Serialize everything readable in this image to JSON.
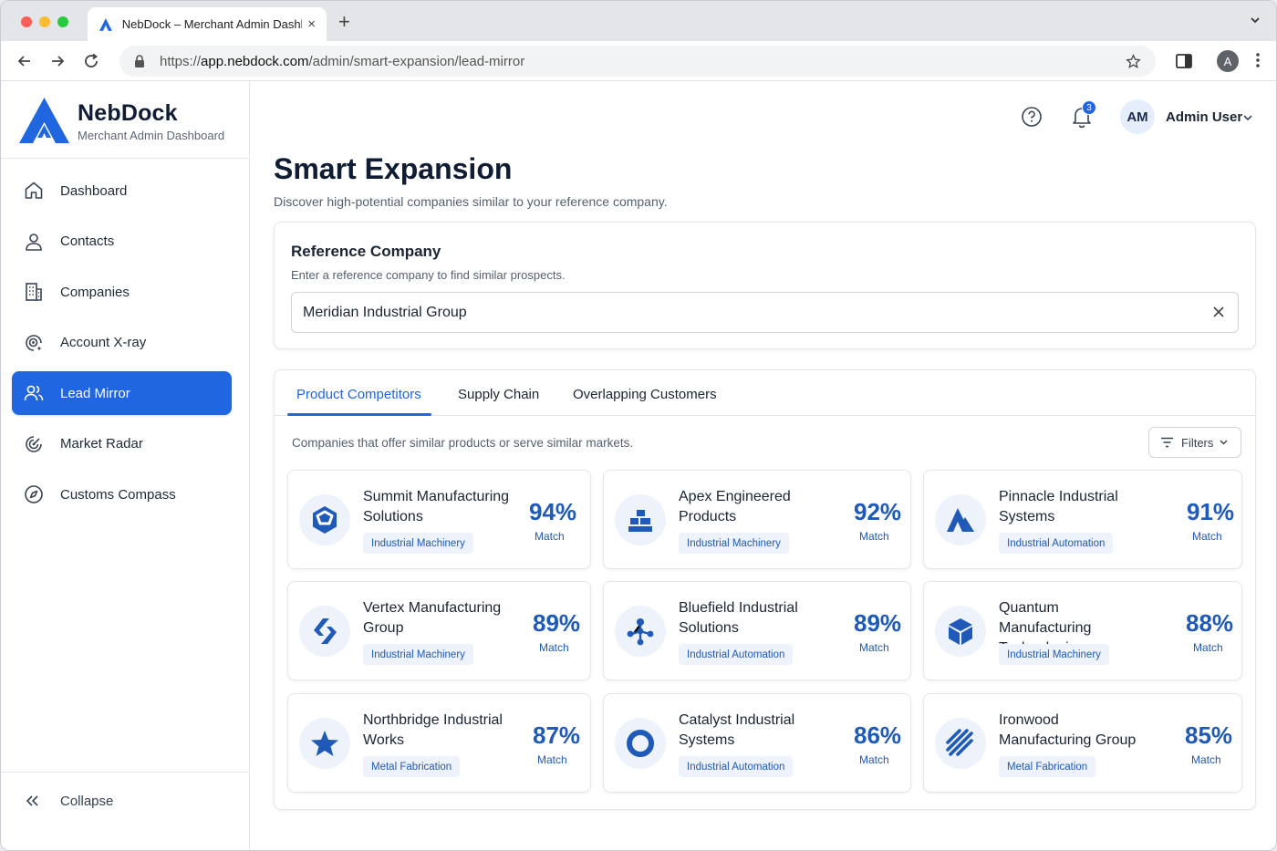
{
  "browser": {
    "tab_title": "NebDock – Merchant Admin Dashboard",
    "new_tab_label": "+",
    "url_scheme": "https://",
    "url_host": "app.nebdock.com",
    "url_path": "/admin/smart-expansion/lead-mirror",
    "profile_initial": "A",
    "close_label": "×"
  },
  "sidebar": {
    "brand_name": "NebDock",
    "brand_sub": "Merchant Admin Dashboard",
    "items": [
      {
        "label": "Dashboard",
        "icon": "home-icon",
        "active": false
      },
      {
        "label": "Contacts",
        "icon": "user-icon",
        "active": false
      },
      {
        "label": "Companies",
        "icon": "building-icon",
        "active": false
      },
      {
        "label": "Account X-ray",
        "icon": "xray-icon",
        "active": false
      },
      {
        "label": "Lead Mirror",
        "icon": "users-icon",
        "active": true
      },
      {
        "label": "Market Radar",
        "icon": "radar-icon",
        "active": false
      },
      {
        "label": "Customs Compass",
        "icon": "compass-icon",
        "active": false
      }
    ],
    "collapse_label": "Collapse"
  },
  "topbar": {
    "notification_count": "3",
    "avatar_initials": "AM",
    "user_name": "Admin User"
  },
  "page": {
    "title": "Smart Expansion",
    "subtitle": "Discover high-potential companies similar to your reference company."
  },
  "reference": {
    "title": "Reference Company",
    "hint": "Enter a reference company to find similar prospects.",
    "value": "Meridian Industrial Group"
  },
  "results": {
    "tabs": [
      {
        "label": "Product Competitors",
        "active": true
      },
      {
        "label": "Supply Chain",
        "active": false
      },
      {
        "label": "Overlapping Customers",
        "active": false
      }
    ],
    "description": "Companies that offer similar products or serve similar markets.",
    "filters_label": "Filters",
    "match_label": "Match",
    "companies": [
      {
        "name": "Summit Manufacturing Solutions",
        "tag": "Industrial Machinery",
        "match": "94%",
        "icon": "hexagon-icon"
      },
      {
        "name": "Apex Engineered Products",
        "tag": "Industrial Machinery",
        "match": "92%",
        "icon": "blocks-icon"
      },
      {
        "name": "Pinnacle Industrial Systems",
        "tag": "Industrial Automation",
        "match": "91%",
        "icon": "peaks-icon"
      },
      {
        "name": "Vertex Manufacturing Group",
        "tag": "Industrial Machinery",
        "match": "89%",
        "icon": "chevrons-icon"
      },
      {
        "name": "Bluefield Industrial Solutions",
        "tag": "Industrial Automation",
        "match": "89%",
        "icon": "network-icon"
      },
      {
        "name": "Quantum Manufacturing Technologies",
        "tag": "Industrial Machinery",
        "match": "88%",
        "icon": "cube-icon"
      },
      {
        "name": "Northbridge Industrial Works",
        "tag": "Metal Fabrication",
        "match": "87%",
        "icon": "star-icon"
      },
      {
        "name": "Catalyst Industrial Systems",
        "tag": "Industrial Automation",
        "match": "86%",
        "icon": "ring-icon"
      },
      {
        "name": "Ironwood Manufacturing Group",
        "tag": "Metal Fabrication",
        "match": "85%",
        "icon": "stripes-icon"
      }
    ]
  },
  "colors": {
    "accent": "#1f66e0",
    "match_text": "#1f5ab8",
    "tag_bg": "#edf2fb"
  }
}
